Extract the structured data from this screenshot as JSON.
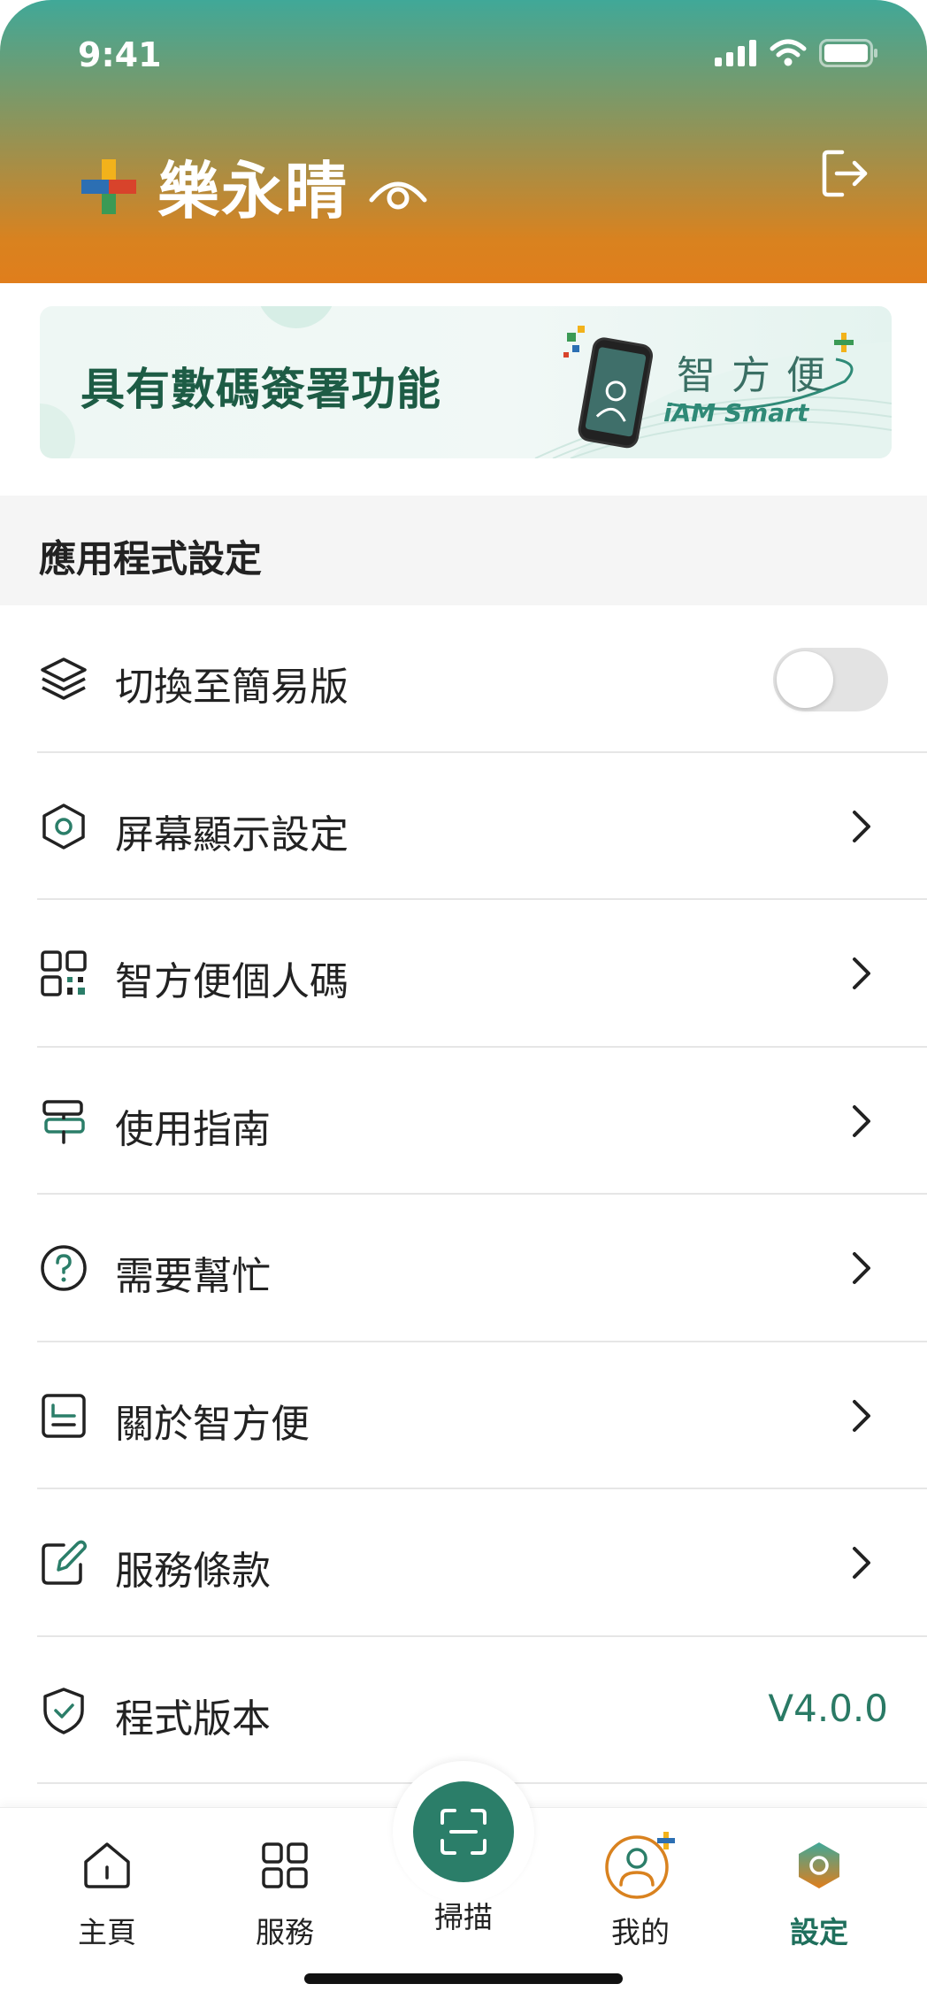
{
  "status_bar": {
    "time": "9:41"
  },
  "header": {
    "user_name": "樂永晴"
  },
  "banner": {
    "text": "具有數碼簽署功能",
    "brand_zh": "智方便",
    "brand_en": "iAM Smart"
  },
  "section": {
    "title": "應用程式設定"
  },
  "menu": {
    "items": [
      {
        "label": "切換至簡易版",
        "icon": "layers-icon",
        "control": "toggle",
        "toggle_on": false
      },
      {
        "label": "屏幕顯示設定",
        "icon": "hexagon-settings-icon",
        "control": "chevron"
      },
      {
        "label": "智方便個人碼",
        "icon": "qr-code-icon",
        "control": "chevron"
      },
      {
        "label": "使用指南",
        "icon": "signpost-icon",
        "control": "chevron"
      },
      {
        "label": "需要幫忙",
        "icon": "help-circle-icon",
        "control": "chevron"
      },
      {
        "label": "關於智方便",
        "icon": "info-card-icon",
        "control": "chevron"
      },
      {
        "label": "服務條款",
        "icon": "edit-document-icon",
        "control": "chevron"
      },
      {
        "label": "程式版本",
        "icon": "shield-check-icon",
        "control": "value",
        "value": "V4.0.0"
      }
    ]
  },
  "tabbar": {
    "home": "主頁",
    "services": "服務",
    "scan": "掃描",
    "mine": "我的",
    "settings": "設定",
    "active": "settings"
  },
  "colors": {
    "accent": "#2b7e69",
    "header_top": "#40a898",
    "header_bottom": "#e07e1c",
    "version_text": "#2a7a65"
  }
}
